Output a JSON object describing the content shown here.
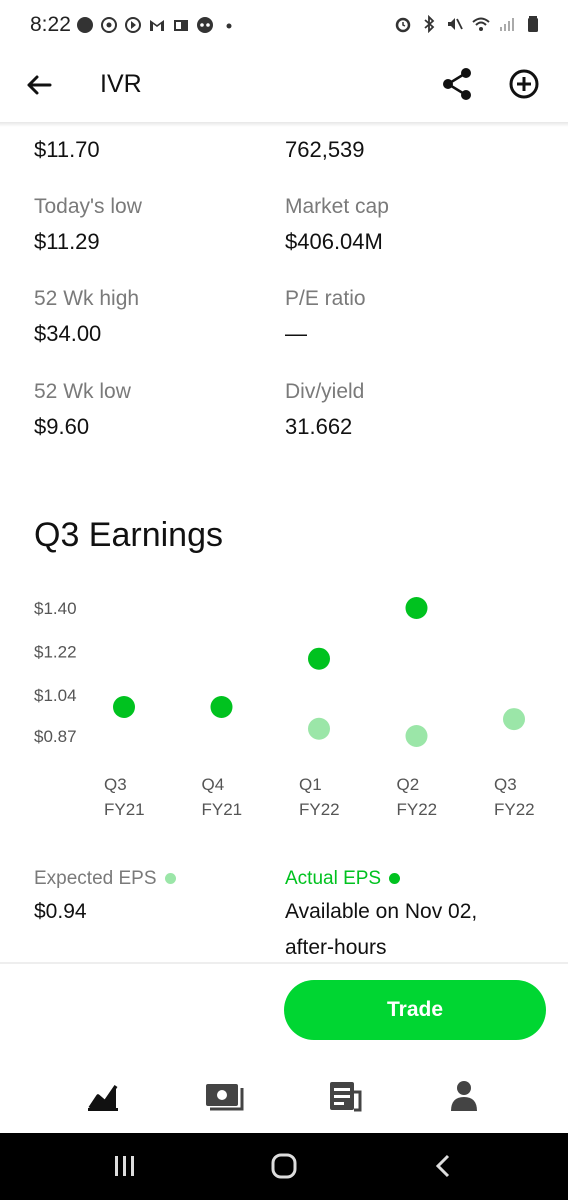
{
  "status_bar": {
    "time": "8:22"
  },
  "header": {
    "ticker": "IVR",
    "icons": [
      "back-arrow-icon",
      "share-icon",
      "add-circle-icon"
    ]
  },
  "stats": {
    "row0": {
      "left_value": "$11.70",
      "right_value": "762,539"
    },
    "todays_low_label": "Today's low",
    "todays_low_value": "$11.29",
    "market_cap_label": "Market cap",
    "market_cap_value": "$406.04M",
    "wk52_high_label": "52 Wk high",
    "wk52_high_value": "$34.00",
    "pe_ratio_label": "P/E ratio",
    "pe_ratio_value": "—",
    "wk52_low_label": "52 Wk low",
    "wk52_low_value": "$9.60",
    "div_yield_label": "Div/yield",
    "div_yield_value": "31.662"
  },
  "earnings": {
    "title": "Q3 Earnings"
  },
  "chart_data": {
    "type": "scatter",
    "y_tick_labels": [
      "$1.40",
      "$1.22",
      "$1.04",
      "$0.87"
    ],
    "y_ticks": [
      1.4,
      1.22,
      1.04,
      0.87
    ],
    "categories": [
      "Q3 FY21",
      "Q4 FY21",
      "Q1 FY22",
      "Q2 FY22",
      "Q3 FY22"
    ],
    "category_lines": [
      [
        "Q3",
        "FY21"
      ],
      [
        "Q4",
        "FY21"
      ],
      [
        "Q1",
        "FY22"
      ],
      [
        "Q2",
        "FY22"
      ],
      [
        "Q3",
        "FY22"
      ]
    ],
    "series": [
      {
        "name": "Expected EPS",
        "color": "#9be6a8",
        "values": [
          null,
          null,
          0.9,
          0.87,
          0.94
        ]
      },
      {
        "name": "Actual EPS",
        "color": "#00c21f",
        "values": [
          0.99,
          0.99,
          1.19,
          1.4,
          null
        ]
      }
    ],
    "ylim": [
      0.87,
      1.4
    ],
    "grid": false
  },
  "legend": {
    "expected_label": "Expected EPS",
    "expected_value": "$0.94",
    "expected_color": "#9be6a8",
    "actual_label": "Actual EPS",
    "actual_color": "#00c21f",
    "actual_value_line1": "Available on Nov 02,",
    "actual_value_line2": "after-hours"
  },
  "trade_button": {
    "label": "Trade",
    "color": "#00d632"
  },
  "bottom_nav": {
    "items": [
      "chart-icon",
      "money-icon",
      "news-icon",
      "profile-icon"
    ]
  }
}
